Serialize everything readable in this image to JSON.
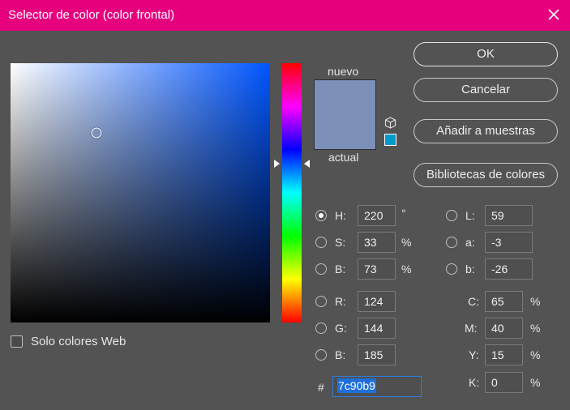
{
  "window": {
    "title": "Selector de color (color frontal)",
    "title_bar_color": "#e6007e"
  },
  "picker": {
    "current_hue_hex": "#0055ff",
    "cursor_saturation": 0.33,
    "cursor_brightness": 0.73,
    "hue_slider_value": 220,
    "web_only_label": "Solo colores Web",
    "web_only_checked": false
  },
  "preview": {
    "new_label": "nuevo",
    "old_label": "actual",
    "new_color": "#7c90b9",
    "old_color": "#7c90b9",
    "out_of_gamut_icon": "cube-icon",
    "websafe_color": "#0099cc"
  },
  "buttons": {
    "ok": "OK",
    "cancel": "Cancelar",
    "add_to_swatches": "Añadir a muestras",
    "color_libraries": "Bibliotecas de colores"
  },
  "fields": {
    "hsb": [
      {
        "label": "H:",
        "value": "220",
        "unit": "°",
        "checked": true
      },
      {
        "label": "S:",
        "value": "33",
        "unit": "%",
        "checked": false
      },
      {
        "label": "B:",
        "value": "73",
        "unit": "%",
        "checked": false
      }
    ],
    "rgb": [
      {
        "label": "R:",
        "value": "124",
        "checked": false
      },
      {
        "label": "G:",
        "value": "144",
        "checked": false
      },
      {
        "label": "B:",
        "value": "185",
        "checked": false
      }
    ],
    "lab": [
      {
        "label": "L:",
        "value": "59",
        "checked": false
      },
      {
        "label": "a:",
        "value": "-3",
        "checked": false
      },
      {
        "label": "b:",
        "value": "-26",
        "checked": false
      }
    ],
    "cmyk": [
      {
        "label": "C:",
        "value": "65",
        "unit": "%"
      },
      {
        "label": "M:",
        "value": "40",
        "unit": "%"
      },
      {
        "label": "Y:",
        "value": "15",
        "unit": "%"
      },
      {
        "label": "K:",
        "value": "0",
        "unit": "%"
      }
    ],
    "hex_label": "#",
    "hex_value": "7c90b9"
  }
}
